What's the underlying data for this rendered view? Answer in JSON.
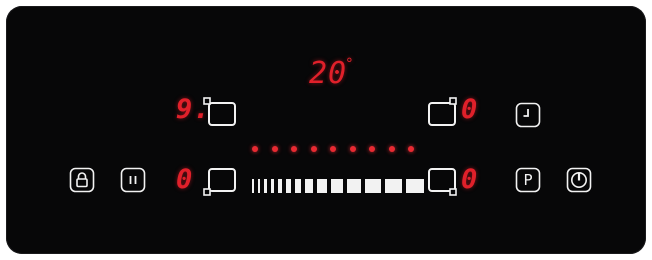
{
  "cooktop_panel": {
    "timer_display": {
      "value": "20",
      "unit_mark": "°"
    },
    "zones": {
      "front_left": {
        "level": "9.",
        "indicator_icon": "zone-front-left-icon"
      },
      "rear_left": {
        "level": "0",
        "indicator_icon": "zone-rear-left-icon"
      },
      "front_right": {
        "level": "0",
        "indicator_icon": "zone-front-right-icon"
      },
      "rear_right": {
        "level": "0",
        "indicator_icon": "zone-rear-right-icon"
      }
    },
    "buttons": {
      "lock": {
        "icon": "lock-icon"
      },
      "pause": {
        "icon": "pause-icon"
      },
      "timer": {
        "icon": "timer-icon"
      },
      "power_boost": {
        "label": "P",
        "icon": "p-icon"
      },
      "power": {
        "icon": "power-icon"
      }
    },
    "slider": {
      "led_count": 9,
      "leds_lit": 9,
      "level_fraction": 1.0
    },
    "colors": {
      "panel_background": "#070708",
      "digit_red": "#e0202a",
      "led_red": "#e82a32",
      "icon_white": "#f2f2f2"
    }
  }
}
